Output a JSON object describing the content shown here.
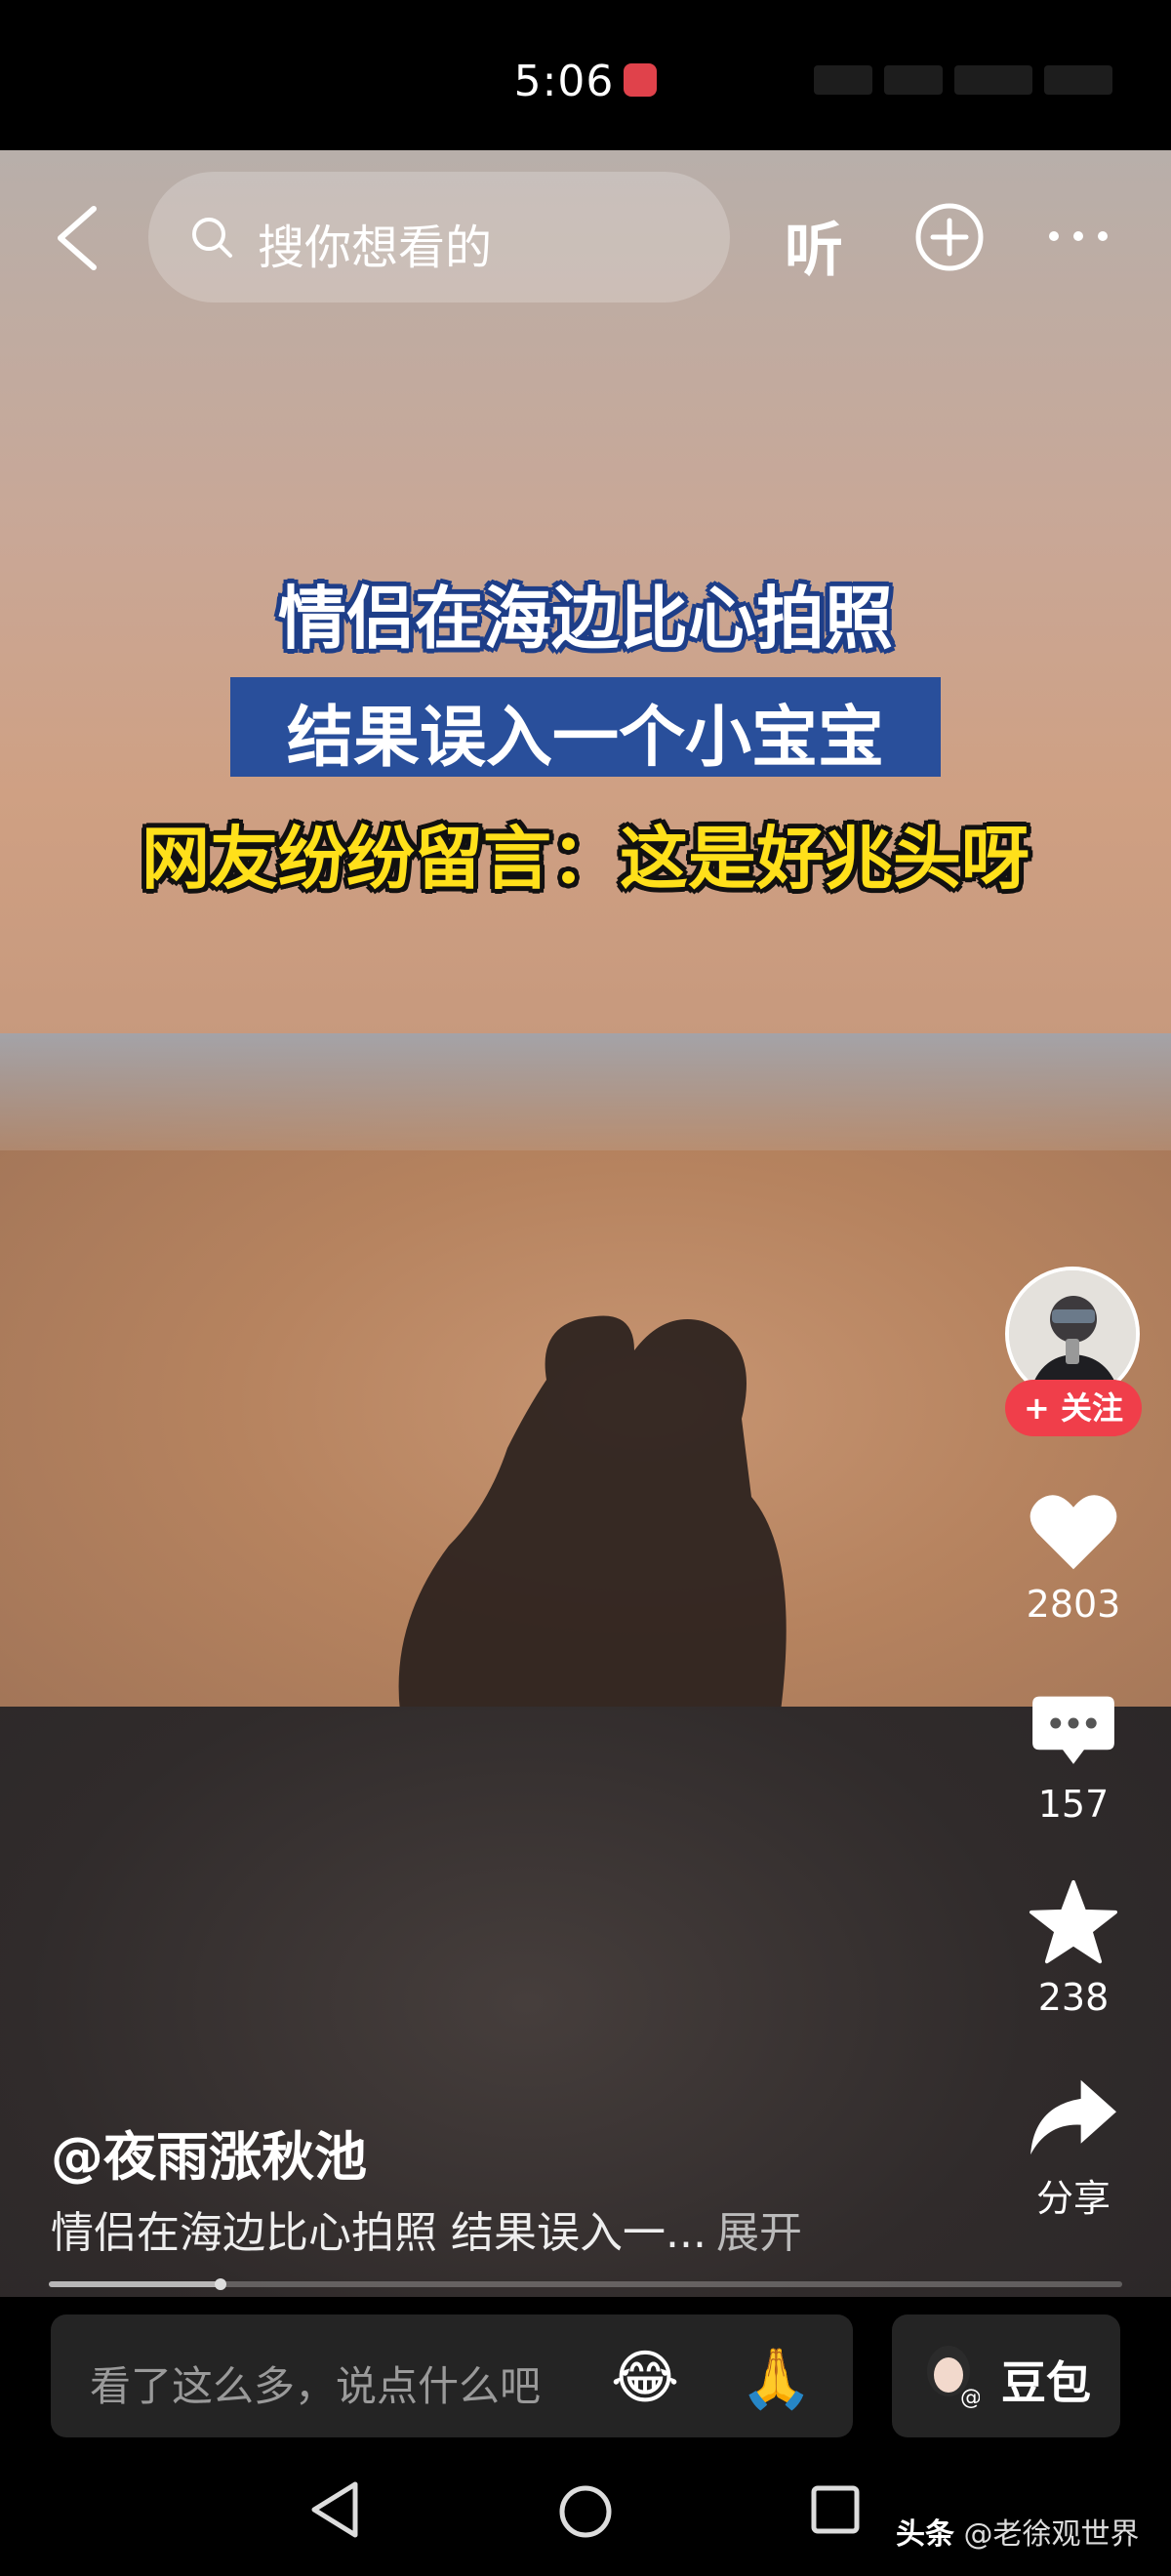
{
  "status_bar": {
    "time": "5:06"
  },
  "top_bar": {
    "search_placeholder": "搜你想看的",
    "listen_label": "听",
    "icons": [
      "back-icon",
      "search-icon",
      "add-circle-icon",
      "more-icon"
    ]
  },
  "video": {
    "captions": [
      "情侣在海边比心拍照",
      "结果误入一个小宝宝",
      "网友纷纷留言：这是好兆头呀"
    ]
  },
  "right_rail": {
    "follow_label": "+ 关注",
    "likes": "2803",
    "comments": "157",
    "favorites": "238",
    "share_label": "分享",
    "icons": [
      "heart-icon",
      "comment-icon",
      "star-icon",
      "share-icon"
    ]
  },
  "post": {
    "author": "@夜雨涨秋池",
    "description": "情侣在海边比心拍照 结果误入一...",
    "expand_label": "展开",
    "progress": 0.16
  },
  "comment_bar": {
    "placeholder": "看了这么多，说点什么吧",
    "emoji_1": "😂",
    "emoji_2": "🙏",
    "doubao_label": "豆包"
  },
  "watermark": {
    "source": "头条",
    "handle": "@老徐观世界"
  },
  "colors": {
    "follow_red": "#f03e4a",
    "caption_blue": "#294f9b",
    "caption_yellow": "#ffe01a",
    "status_badge": "#e0424b"
  }
}
